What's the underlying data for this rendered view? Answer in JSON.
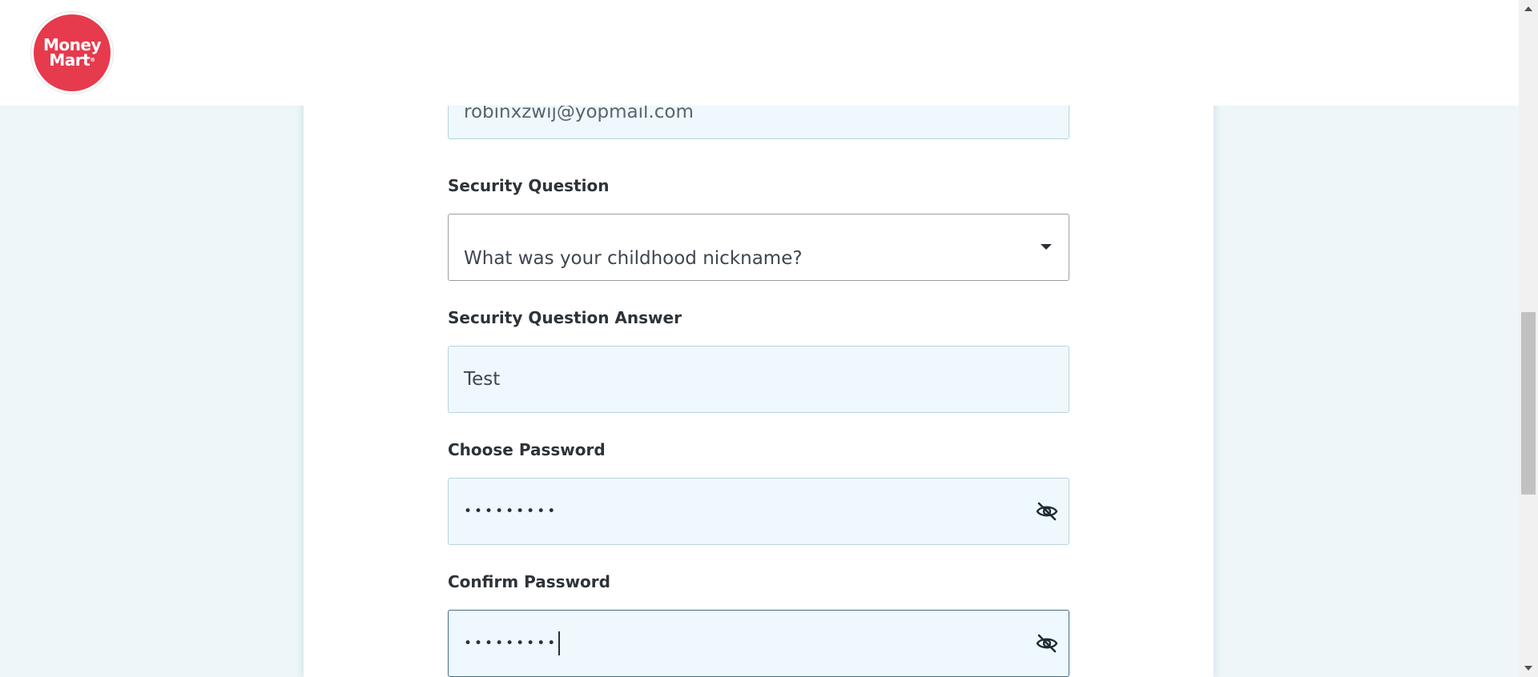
{
  "brand": {
    "logo_line1": "Money",
    "logo_line2": "Mart"
  },
  "form": {
    "email_value": "robinxzwij@yopmail.com",
    "security_question_label": "Security Question",
    "security_question_value": "What was your childhood nickname?",
    "security_answer_label": "Security Question Answer",
    "security_answer_value": "Test",
    "choose_password_label": "Choose Password",
    "choose_password_value": "•••••••••",
    "confirm_password_label": "Confirm Password",
    "confirm_password_value": "•••••••••"
  },
  "icons": {
    "logo": "money-mart-logo",
    "select_caret": "chevron-down-icon",
    "password_toggle": "eye-slash-icon"
  },
  "colors": {
    "brand_red": "#e63a4d",
    "page_background": "#eef6f9",
    "input_background": "#eef8fd",
    "label_text": "#2d3339"
  }
}
